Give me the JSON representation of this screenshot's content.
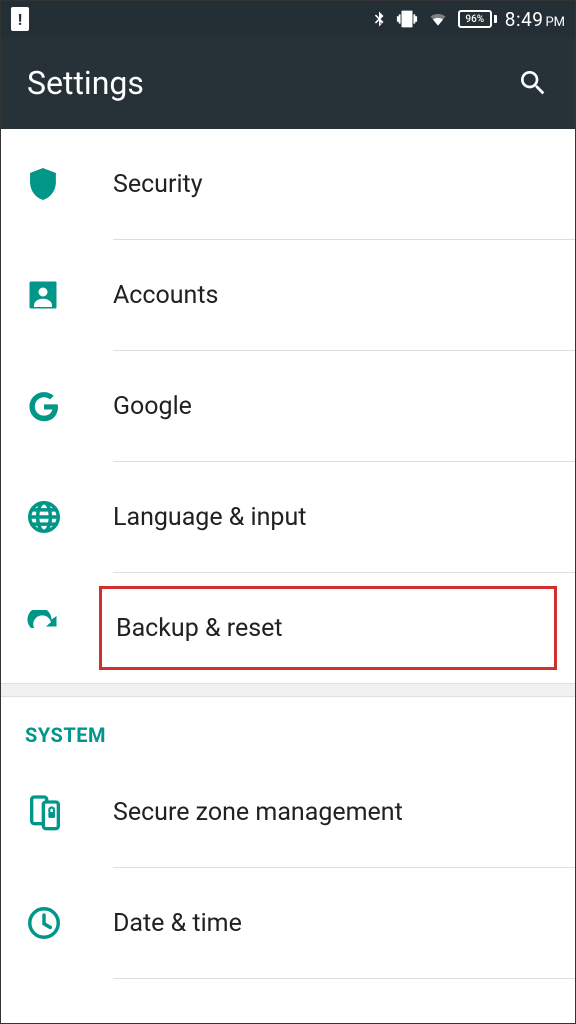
{
  "status": {
    "battery_pct": "96%",
    "time": "8:49",
    "ampm": "PM"
  },
  "header": {
    "title": "Settings"
  },
  "items": [
    {
      "icon": "shield-icon",
      "label": "Security"
    },
    {
      "icon": "account-icon",
      "label": "Accounts"
    },
    {
      "icon": "google-icon",
      "label": "Google"
    },
    {
      "icon": "globe-icon",
      "label": "Language & input"
    },
    {
      "icon": "refresh-icon",
      "label": "Backup & reset",
      "highlighted": true
    }
  ],
  "section": {
    "title": "SYSTEM",
    "items": [
      {
        "icon": "secure-phone-icon",
        "label": "Secure zone management"
      },
      {
        "icon": "clock-icon",
        "label": "Date & time"
      }
    ]
  }
}
